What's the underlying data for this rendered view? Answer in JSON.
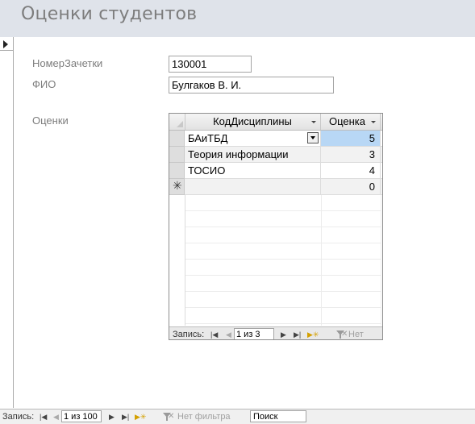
{
  "form": {
    "title": "Оценки студентов"
  },
  "fields": {
    "record_book_label": "НомерЗачетки",
    "record_book_value": "130001",
    "fio_label": "ФИО",
    "fio_value": "Булгаков В. И.",
    "grades_label": "Оценки"
  },
  "subform": {
    "columns": [
      "КодДисциплины",
      "Оценка"
    ],
    "rows": [
      {
        "discipline": "БАиТБД",
        "grade": "5"
      },
      {
        "discipline": "Теория информации",
        "grade": "3"
      },
      {
        "discipline": "ТОСИО",
        "grade": "4"
      }
    ],
    "new_row_marker": "✳",
    "new_row_grade": "0",
    "nav": {
      "record_label": "Запись:",
      "position": "1 из 3",
      "filter_label": "Нет фил"
    }
  },
  "main_nav": {
    "record_label": "Запись:",
    "position": "1 из 100",
    "filter_label": "Нет фильтра",
    "search_placeholder": "Поиск"
  },
  "icons": {
    "first": "first-record-icon",
    "prev": "prev-record-icon",
    "next": "next-record-icon",
    "last": "last-record-icon",
    "new": "new-record-icon",
    "filter": "no-filter-icon"
  },
  "colors": {
    "header_bg": "#dfe3ea",
    "title_color": "#7d7d7d",
    "current_cell": "#b8d7f5"
  }
}
